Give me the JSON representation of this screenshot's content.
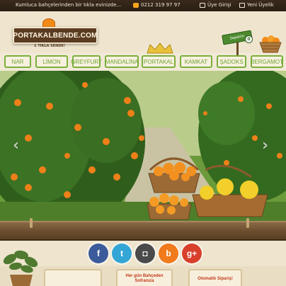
{
  "topbar": {
    "promo": "Kumluca bahçelerinden bir tıkla evinizde...",
    "phone": "0212 319 97 97",
    "login": "Üye Girişi",
    "register": "Yeni Üyelik"
  },
  "header": {
    "logo": "PORTAKALBENDE.COM",
    "tagline": "1 TIKLA SENDE!",
    "cart_label": "Sepetim",
    "cart_count": "0"
  },
  "nav": {
    "items": [
      {
        "label": "NAR"
      },
      {
        "label": "LİMON"
      },
      {
        "label": "GREYFURT"
      },
      {
        "label": "MANDALİNA"
      },
      {
        "label": "PORTAKAL"
      },
      {
        "label": "KAMKAT"
      },
      {
        "label": "ŞADOKS"
      },
      {
        "label": "BERGAMOT"
      }
    ]
  },
  "hero": {
    "prev_label": "‹",
    "next_label": "›"
  },
  "social": {
    "facebook": "f",
    "twitter": "t",
    "instagram": "◘",
    "blogger": "b",
    "googleplus": "g+"
  },
  "bottom": {
    "card1": "",
    "card2": "Her gün Bahçeden Sofranıza",
    "card3": "Otomatik Sipariş!"
  },
  "colors": {
    "brand_green": "#7ab03b",
    "brand_brown": "#5a3c22",
    "orange": "#f28a17"
  }
}
